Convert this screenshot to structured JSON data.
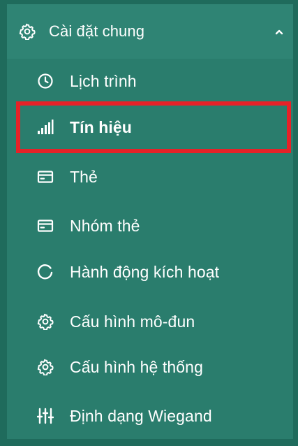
{
  "group": {
    "label": "Cài đặt chung",
    "icon": "gear-icon",
    "expanded_indicator": "chevron-up-icon"
  },
  "items": [
    {
      "label": "Lịch trình",
      "icon": "clock-icon"
    },
    {
      "label": "Tín hiệu",
      "icon": "signal-bars-icon",
      "selected": true
    },
    {
      "label": "Thẻ",
      "icon": "card-icon"
    },
    {
      "label": "Nhóm thẻ",
      "icon": "card-icon"
    },
    {
      "label": "Hành động kích hoạt",
      "icon": "reload-icon"
    },
    {
      "label": "Cấu hình mô-đun",
      "icon": "gear-icon"
    },
    {
      "label": "Cấu hình hệ thống",
      "icon": "gear-icon"
    },
    {
      "label": "Định dạng Wiegand",
      "icon": "sliders-icon"
    }
  ],
  "colors": {
    "background": "#2a7d6d",
    "header_background": "#2f8474",
    "text": "#ffffff",
    "highlight_border": "#e52228"
  }
}
